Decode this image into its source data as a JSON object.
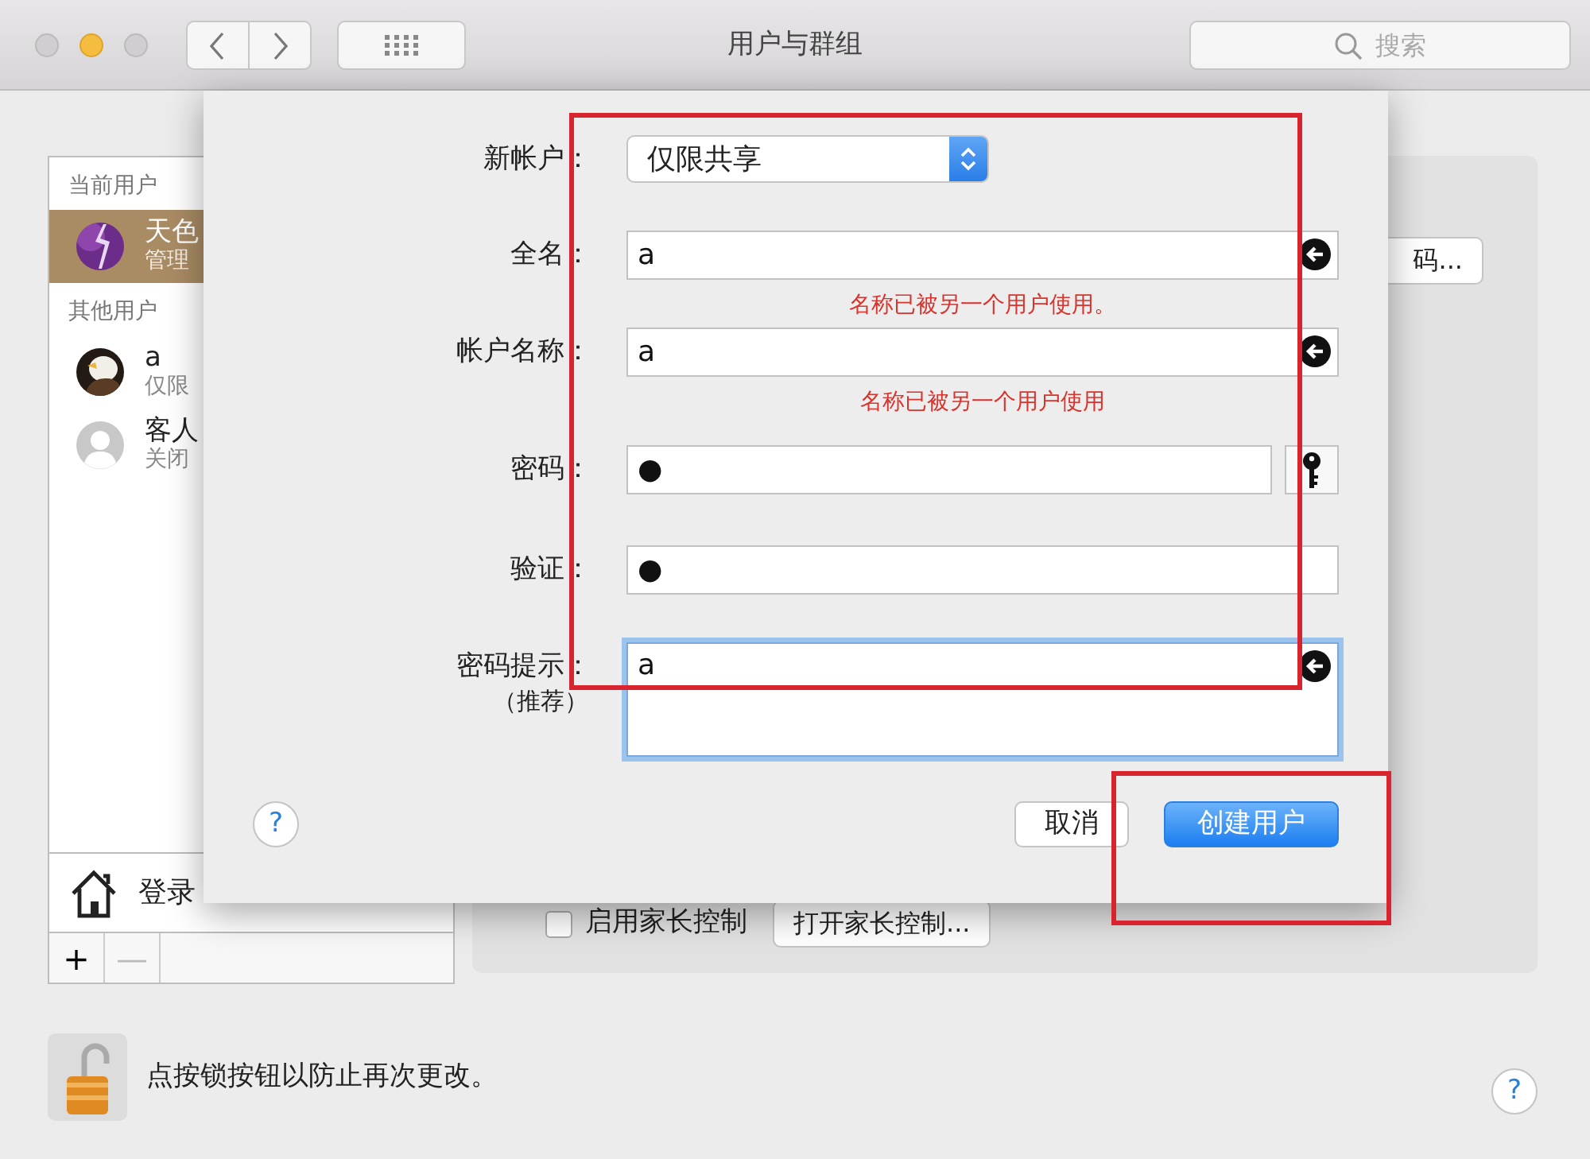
{
  "window": {
    "title": "用户与群组",
    "search": {
      "placeholder": "搜索"
    }
  },
  "sidebar": {
    "sections": [
      {
        "heading": "当前用户",
        "users": [
          {
            "name": "天色",
            "role": "管理",
            "selected": true,
            "kind": "lightning"
          }
        ]
      },
      {
        "heading": "其他用户",
        "users": [
          {
            "name": "a",
            "role": "仅限",
            "selected": false,
            "kind": "eagle"
          },
          {
            "name": "客人",
            "role": "关闭",
            "selected": false,
            "kind": "silhouette"
          }
        ]
      }
    ],
    "login_options": "登录",
    "list_buttons": [
      {
        "label": "+",
        "disabled": false
      },
      {
        "label": "—",
        "disabled": true
      }
    ]
  },
  "right_panel": {
    "password_button": "码...",
    "parental_checkbox": {
      "label": "启用家长控制",
      "checked": false
    },
    "parental_button": "打开家长控制..."
  },
  "sheet": {
    "fields": [
      {
        "label": "新帐户：",
        "kind": "popup",
        "value": "仅限共享"
      },
      {
        "label": "全名：",
        "kind": "text",
        "value": "a",
        "error": "名称已被另一个用户使用。",
        "clear": true
      },
      {
        "label": "帐户名称：",
        "kind": "text",
        "value": "a",
        "error": "名称已被另一个用户使用",
        "clear": true
      },
      {
        "label": "密码：",
        "kind": "password",
        "value": "●",
        "key": true
      },
      {
        "label": "验证：",
        "kind": "password",
        "value": "●"
      },
      {
        "label": "密码提示：",
        "sublabel": "（推荐）",
        "kind": "textarea",
        "value": "a",
        "clear": true,
        "focused": true
      }
    ],
    "help": "?",
    "buttons": [
      {
        "label": "取消",
        "default": false
      },
      {
        "label": "创建用户",
        "default": true
      }
    ]
  },
  "footer": {
    "lock_text": "点按锁按钮以防止再次更改。",
    "locked": false,
    "help": "?"
  }
}
